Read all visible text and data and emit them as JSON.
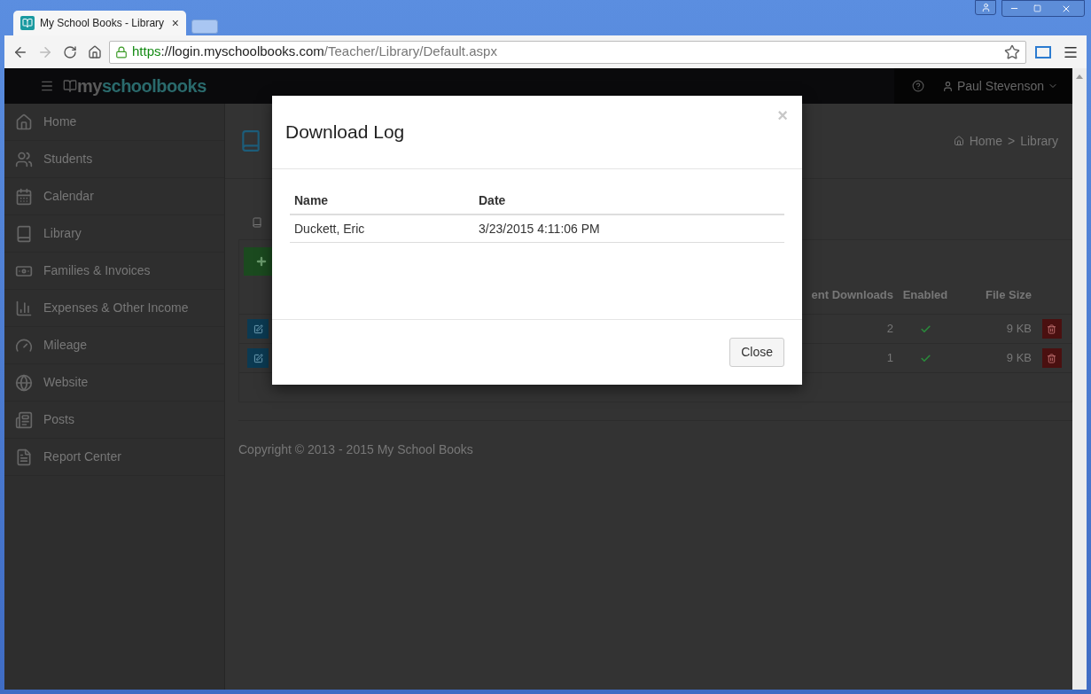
{
  "browser": {
    "tab_title": "My School Books - Library",
    "close_glyph": "×",
    "url": {
      "scheme": "https",
      "host": "://login.myschoolbooks.com",
      "path": "/Teacher/Library/Default.aspx"
    }
  },
  "navbar": {
    "brand_prefix": "my",
    "brand_suffix": "schoolbooks",
    "user": "Paul Stevenson"
  },
  "sidebar": {
    "items": [
      {
        "label": "Home"
      },
      {
        "label": "Students"
      },
      {
        "label": "Calendar"
      },
      {
        "label": "Library"
      },
      {
        "label": "Families & Invoices"
      },
      {
        "label": "Expenses & Other Income"
      },
      {
        "label": "Mileage"
      },
      {
        "label": "Website"
      },
      {
        "label": "Posts"
      },
      {
        "label": "Report Center"
      }
    ]
  },
  "breadcrumb": {
    "items": [
      "Home",
      "Library"
    ],
    "separator": ">"
  },
  "files_table": {
    "columns": [
      "ent Downloads",
      "Enabled",
      "File Size"
    ],
    "rows": [
      {
        "downloads": "2",
        "enabled": true,
        "size": "9 KB"
      },
      {
        "downloads": "1",
        "enabled": true,
        "size": "9 KB"
      }
    ]
  },
  "footer": {
    "copyright": "Copyright © 2013 - 2015 My School Books"
  },
  "modal": {
    "title": "Download Log",
    "close_glyph": "×",
    "columns": [
      "Name",
      "Date"
    ],
    "rows": [
      [
        "Duckett, Eric",
        "3/23/2015 4:11:06 PM"
      ]
    ],
    "close_button": "Close"
  }
}
